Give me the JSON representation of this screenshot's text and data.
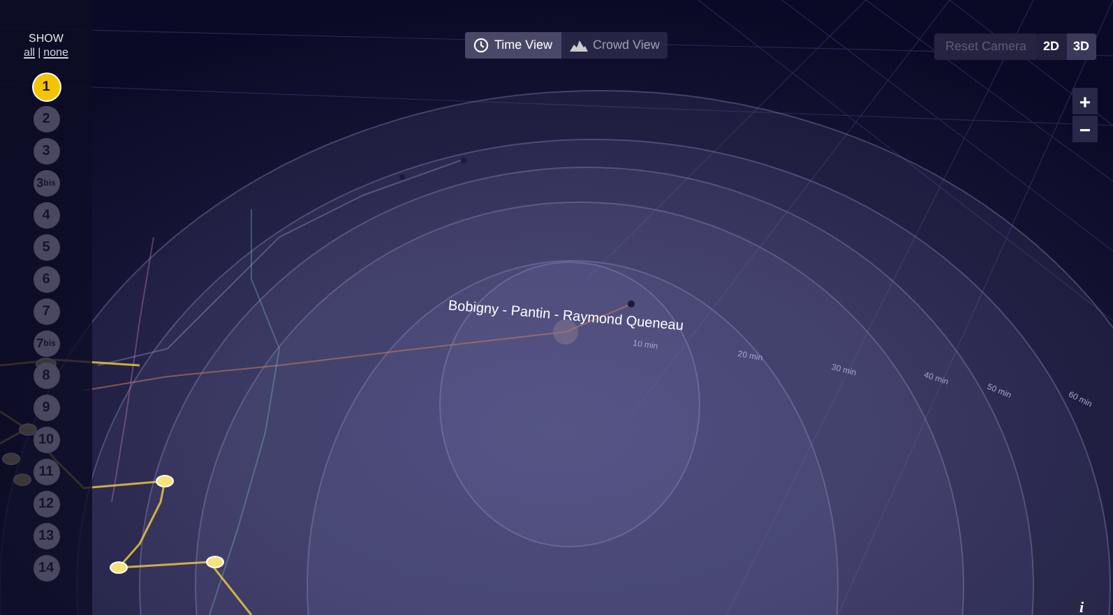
{
  "sidebar": {
    "show_label": "SHOW",
    "all_link": "all",
    "separator": "|",
    "none_link": "none",
    "lines": [
      {
        "number": "1",
        "selected": true
      },
      {
        "number": "2",
        "selected": false
      },
      {
        "number": "3",
        "selected": false
      },
      {
        "number": "3",
        "suffix": "bis",
        "selected": false
      },
      {
        "number": "4",
        "selected": false
      },
      {
        "number": "5",
        "selected": false
      },
      {
        "number": "6",
        "selected": false
      },
      {
        "number": "7",
        "selected": false
      },
      {
        "number": "7",
        "suffix": "bis",
        "selected": false
      },
      {
        "number": "8",
        "selected": false
      },
      {
        "number": "9",
        "selected": false
      },
      {
        "number": "10",
        "selected": false
      },
      {
        "number": "11",
        "selected": false
      },
      {
        "number": "12",
        "selected": false
      },
      {
        "number": "13",
        "selected": false
      },
      {
        "number": "14",
        "selected": false
      }
    ]
  },
  "view_tabs": [
    {
      "label": "Time View",
      "kind": "clock",
      "selected": true
    },
    {
      "label": "Crowd View",
      "kind": "crowd",
      "selected": false
    }
  ],
  "reset_camera": {
    "label": "Reset Camera",
    "disabled": true
  },
  "dimension_toggle": [
    {
      "label": "2D",
      "selected": false
    },
    {
      "label": "3D",
      "selected": true
    }
  ],
  "zoom": {
    "in": "+",
    "out": "−"
  },
  "map": {
    "station": "Bobigny - Pantin - Raymond Queneau",
    "rings": [
      "10 min",
      "20 min",
      "30 min",
      "40 min",
      "50 min",
      "60 min"
    ]
  },
  "info_button": "i"
}
